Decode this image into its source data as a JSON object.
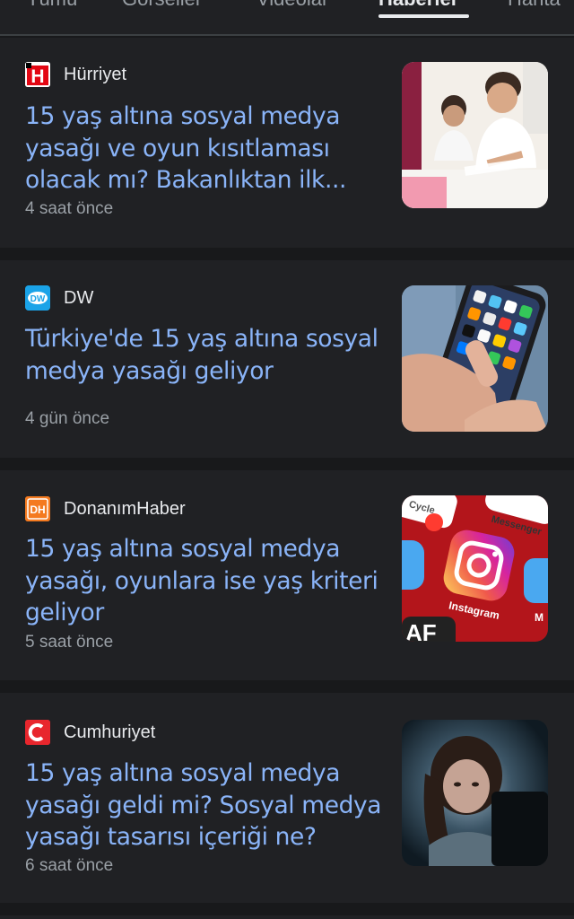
{
  "tabs": [
    {
      "label": "Tümü"
    },
    {
      "label": "Görseller"
    },
    {
      "label": "Videolar"
    },
    {
      "label": "Haberler",
      "active": true
    },
    {
      "label": "Harita"
    }
  ],
  "articles": [
    {
      "source": "Hürriyet",
      "logo_text": "H",
      "headline": "15 yaş altına sosyal medya yasağı ve oyun kısıtlaması olacak mı? Bakanlıktan ilk...",
      "time": "4 saat önce",
      "thumb_icon": "children-at-desk-photo"
    },
    {
      "source": "DW",
      "logo_text": "DW",
      "headline": "Türkiye'de 15 yaş altına sosyal medya yasağı geliyor",
      "time": "4 gün önce",
      "thumb_icon": "hand-holding-smartphone-photo"
    },
    {
      "source": "DonanımHaber",
      "logo_text": "DH",
      "headline": "15 yaş altına sosyal medya yasağı, oyunlara ise yaş kriteri geliyor",
      "time": "5 saat önce",
      "thumb_icon": "instagram-app-icon-photo",
      "thumb_texts": [
        "Cycle",
        "Messenger",
        "Instagram",
        "AF",
        "M"
      ]
    },
    {
      "source": "Cumhuriyet",
      "logo_text": "C",
      "headline": "15 yaş altına sosyal medya yasağı geldi mi? Sosyal medya yasağı tasarısı içeriği ne?",
      "time": "6 saat önce",
      "thumb_icon": "girl-looking-at-screen-photo"
    }
  ],
  "colors": {
    "background": "#18191b",
    "card": "#202124",
    "headline": "#8ab4f8",
    "source": "#e8eaed",
    "time": "#9aa0a6",
    "hurriyet_red": "#e30613",
    "dw_blue": "#0ea5e9",
    "donanimhaber_orange": "#f47a20",
    "cumhuriyet_red": "#e8262d"
  }
}
